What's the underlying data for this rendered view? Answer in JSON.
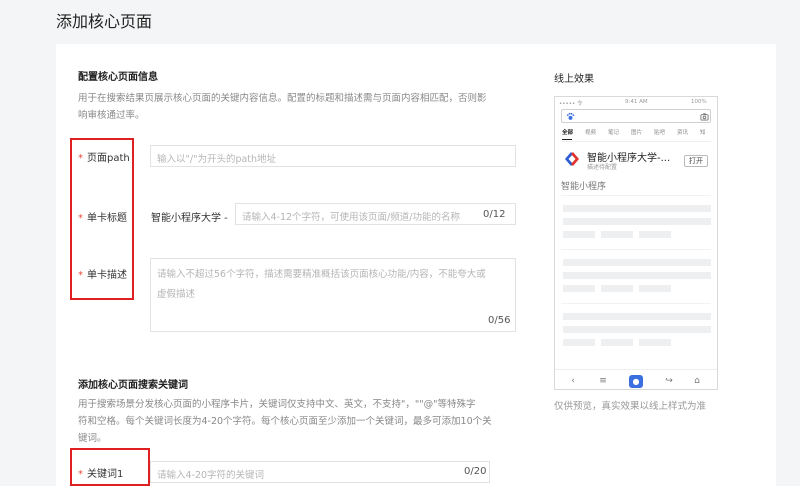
{
  "page": {
    "title": "添加核心页面"
  },
  "config": {
    "title": "配置核心页面信息",
    "desc_line1": "用于在搜索结果页展示核心页面的关键内容信息。配置的标题和描述需与页面内容相匹配，否则影",
    "desc_line2": "响审核通过率。",
    "path": {
      "label": "页面path",
      "placeholder": "输入以\"/\"为开头的path地址"
    },
    "card_title": {
      "label": "单卡标题",
      "prefix": "智能小程序大学 -",
      "placeholder": "请输入4-12个字符，可使用该页面/频道/功能的名称",
      "counter": "0/12"
    },
    "card_desc": {
      "label": "单卡描述",
      "placeholder_line1": "请输入不超过56个字符，描述需要精准概括该页面核心功能/内容，不能夸大或",
      "placeholder_line2": "虚假描述",
      "counter": "0/56"
    },
    "required_mark": "*"
  },
  "keywords": {
    "title": "添加核心页面搜索关键词",
    "desc_line1": "用于搜索场景分发核心页面的小程序卡片，关键词仅支持中文、英文，不支持\"，\"\"@\"等特殊字",
    "desc_line2": "符和空格。每个关键词长度为4-20个字符。每个核心页面至少添加一个关键词，最多可添加10个关",
    "desc_line3": "键词。",
    "keyword1": {
      "label": "关键词1",
      "placeholder": "请输入4-20字符的关键词",
      "counter": "0/20"
    }
  },
  "preview": {
    "title": "线上效果",
    "status_left": "••••• 令",
    "status_time": "9:41 AM",
    "status_right": "100%",
    "tabs": [
      "全部",
      "视频",
      "笔记",
      "图片",
      "贴吧",
      "资讯",
      "知"
    ],
    "card_title": "智能小程序大学-...",
    "card_sub": "描述待配置",
    "open_label": "打开",
    "app_name": "智能小程序",
    "note": "仅供预览，真实效果以线上样式为准",
    "accent_color": "#3b6fe0",
    "logo_color_blue": "#2d5bd1",
    "logo_color_red": "#e0332d"
  },
  "highlight_color": "#e02020"
}
